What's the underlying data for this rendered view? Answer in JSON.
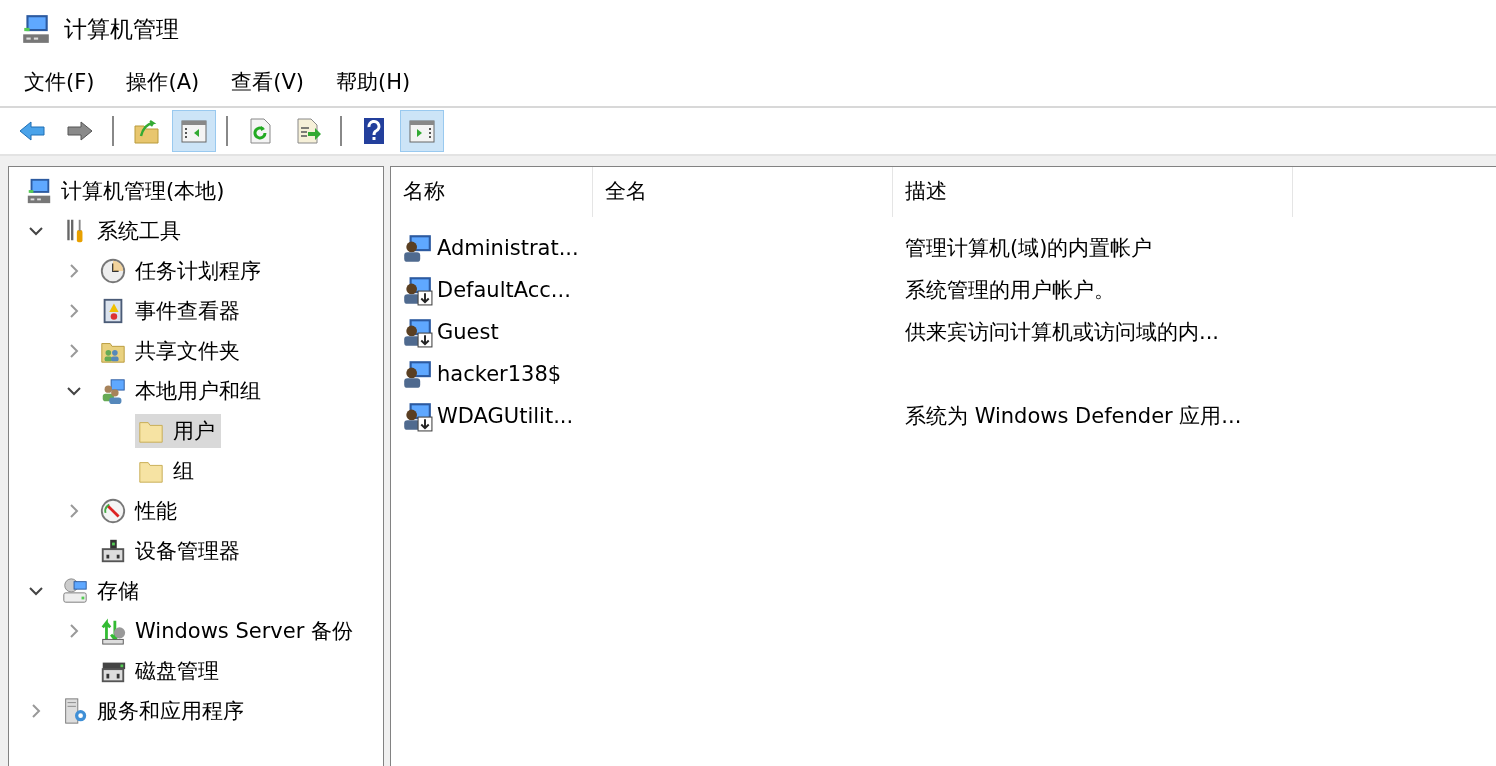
{
  "window": {
    "title": "计算机管理"
  },
  "menu": [
    "文件(F)",
    "操作(A)",
    "查看(V)",
    "帮助(H)"
  ],
  "toolbar": [
    {
      "kind": "back",
      "pressed": false
    },
    {
      "kind": "forward",
      "pressed": false
    },
    {
      "kind": "separator"
    },
    {
      "kind": "up",
      "pressed": false
    },
    {
      "kind": "hidetree",
      "pressed": true
    },
    {
      "kind": "separator"
    },
    {
      "kind": "refresh",
      "pressed": false
    },
    {
      "kind": "export",
      "pressed": false
    },
    {
      "kind": "separator"
    },
    {
      "kind": "help",
      "pressed": false
    },
    {
      "kind": "actionpane",
      "pressed": true
    }
  ],
  "tree": {
    "items": [
      {
        "label": "计算机管理(本地)",
        "kind": "computer",
        "selected": false
      },
      {
        "label": "系统工具",
        "kind": "tools",
        "selected": false,
        "expanded": true,
        "children": [
          {
            "label": "任务计划程序",
            "kind": "clock",
            "selected": false,
            "expanded": false
          },
          {
            "label": "事件查看器",
            "kind": "eventlog",
            "selected": false,
            "expanded": false
          },
          {
            "label": "共享文件夹",
            "kind": "share",
            "selected": false,
            "expanded": false
          },
          {
            "label": "本地用户和组",
            "kind": "users",
            "selected": false,
            "expanded": true,
            "children": [
              {
                "label": "用户",
                "kind": "folder",
                "selected": true
              },
              {
                "label": "组",
                "kind": "folder",
                "selected": false
              }
            ]
          },
          {
            "label": "性能",
            "kind": "gauge",
            "selected": false,
            "expanded": false
          },
          {
            "label": "设备管理器",
            "kind": "device",
            "selected": false
          }
        ]
      },
      {
        "label": "存储",
        "kind": "storage",
        "selected": false,
        "expanded": true,
        "children": [
          {
            "label": "Windows Server 备份",
            "kind": "backup",
            "selected": false,
            "expanded": false
          },
          {
            "label": "磁盘管理",
            "kind": "disk",
            "selected": false
          }
        ]
      },
      {
        "label": "服务和应用程序",
        "kind": "services",
        "selected": false,
        "expanded": false
      }
    ]
  },
  "table": {
    "columns": [
      "名称",
      "全名",
      "描述"
    ],
    "rows": [
      {
        "name": "Administrat...",
        "description": "管理计算机(域)的内置帐户",
        "disabled": false
      },
      {
        "name": "DefaultAcc...",
        "description": "系统管理的用户帐户。",
        "disabled": true
      },
      {
        "name": "Guest",
        "description": "供来宾访问计算机或访问域的内...",
        "disabled": true
      },
      {
        "name": "hacker138$",
        "disabled": false
      },
      {
        "name": "WDAGUtilit...",
        "description": "系统为 Windows Defender 应用...",
        "disabled": true
      }
    ]
  }
}
